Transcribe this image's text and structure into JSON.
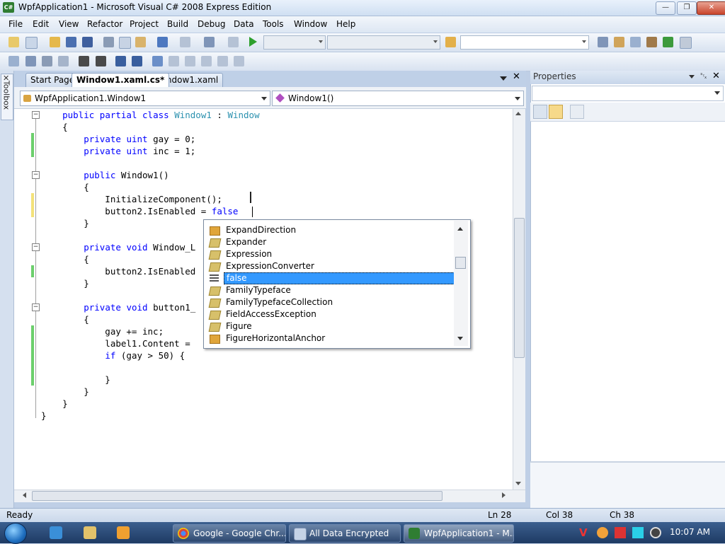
{
  "window": {
    "title": "WpfApplication1 - Microsoft Visual C# 2008 Express Edition",
    "icon_text": "C#"
  },
  "menu": [
    "File",
    "Edit",
    "View",
    "Refactor",
    "Project",
    "Build",
    "Debug",
    "Data",
    "Tools",
    "Window",
    "Help"
  ],
  "toolbox": {
    "label": "Toolbox"
  },
  "tabs": [
    {
      "label": "Start Page",
      "active": false
    },
    {
      "label": "Window1.xaml.cs*",
      "active": true
    },
    {
      "label": "Window1.xaml",
      "active": false
    }
  ],
  "nav": {
    "class_combo": "WpfApplication1.Window1",
    "member_combo": "Window1()"
  },
  "code": {
    "lines": [
      [
        {
          "t": "    "
        },
        {
          "t": "public",
          "c": "kw"
        },
        {
          "t": " "
        },
        {
          "t": "partial",
          "c": "kw"
        },
        {
          "t": " "
        },
        {
          "t": "class",
          "c": "kw"
        },
        {
          "t": " "
        },
        {
          "t": "Window1",
          "c": "ty"
        },
        {
          "t": " : "
        },
        {
          "t": "Window",
          "c": "ty"
        }
      ],
      [
        {
          "t": "    {"
        }
      ],
      [
        {
          "t": "        "
        },
        {
          "t": "private",
          "c": "kw"
        },
        {
          "t": " "
        },
        {
          "t": "uint",
          "c": "kw"
        },
        {
          "t": " gay = 0;"
        }
      ],
      [
        {
          "t": "        "
        },
        {
          "t": "private",
          "c": "kw"
        },
        {
          "t": " "
        },
        {
          "t": "uint",
          "c": "kw"
        },
        {
          "t": " inc = 1;"
        }
      ],
      [
        {
          "t": ""
        }
      ],
      [
        {
          "t": "        "
        },
        {
          "t": "public",
          "c": "kw"
        },
        {
          "t": " Window1()"
        }
      ],
      [
        {
          "t": "        {"
        }
      ],
      [
        {
          "t": "            InitializeComponent();"
        }
      ],
      [
        {
          "t": "            button2.IsEnabled = "
        },
        {
          "t": "false",
          "c": "kw"
        }
      ],
      [
        {
          "t": "        }"
        }
      ],
      [
        {
          "t": ""
        }
      ],
      [
        {
          "t": "        "
        },
        {
          "t": "private",
          "c": "kw"
        },
        {
          "t": " "
        },
        {
          "t": "void",
          "c": "kw"
        },
        {
          "t": " Window_L"
        }
      ],
      [
        {
          "t": "        {"
        }
      ],
      [
        {
          "t": "            button2.IsEnabled"
        }
      ],
      [
        {
          "t": "        }"
        }
      ],
      [
        {
          "t": ""
        }
      ],
      [
        {
          "t": "        "
        },
        {
          "t": "private",
          "c": "kw"
        },
        {
          "t": " "
        },
        {
          "t": "void",
          "c": "kw"
        },
        {
          "t": " button1_"
        }
      ],
      [
        {
          "t": "        {"
        }
      ],
      [
        {
          "t": "            gay += inc;"
        }
      ],
      [
        {
          "t": "            label1.Content ="
        }
      ],
      [
        {
          "t": "            "
        },
        {
          "t": "if",
          "c": "kw"
        },
        {
          "t": " (gay > 50) {"
        }
      ],
      [
        {
          "t": ""
        }
      ],
      [
        {
          "t": "            }"
        }
      ],
      [
        {
          "t": "        }"
        }
      ],
      [
        {
          "t": "    }"
        }
      ],
      [
        {
          "t": "}"
        }
      ]
    ]
  },
  "intellisense": {
    "items": [
      {
        "label": "ExpandDirection",
        "icon": "enum-icon"
      },
      {
        "label": "Expander",
        "icon": "class-icon"
      },
      {
        "label": "Expression",
        "icon": "class-icon"
      },
      {
        "label": "ExpressionConverter",
        "icon": "class-icon"
      },
      {
        "label": "false",
        "icon": "keyword-icon",
        "selected": true
      },
      {
        "label": "FamilyTypeface",
        "icon": "class-icon"
      },
      {
        "label": "FamilyTypefaceCollection",
        "icon": "class-icon"
      },
      {
        "label": "FieldAccessException",
        "icon": "class-icon"
      },
      {
        "label": "Figure",
        "icon": "class-icon"
      },
      {
        "label": "FigureHorizontalAnchor",
        "icon": "enum-icon"
      }
    ]
  },
  "properties": {
    "title": "Properties"
  },
  "status": {
    "ready": "Ready",
    "ln": "Ln 28",
    "col": "Col 38",
    "ch": "Ch 38"
  },
  "taskbar": {
    "buttons": [
      {
        "label": "Google - Google Chr...",
        "icon": "chrome-icon"
      },
      {
        "label": "All Data Encrypted",
        "icon": "window-icon"
      },
      {
        "label": "WpfApplication1 - M...",
        "icon": "vs-icon",
        "active": true
      }
    ],
    "clock": "10:07 AM"
  },
  "colors": {
    "keyword": "#0000ff",
    "type": "#2b91af",
    "selection": "#3399ff",
    "change_saved": "#6ccf6c",
    "change_unsaved": "#f3e27a"
  }
}
